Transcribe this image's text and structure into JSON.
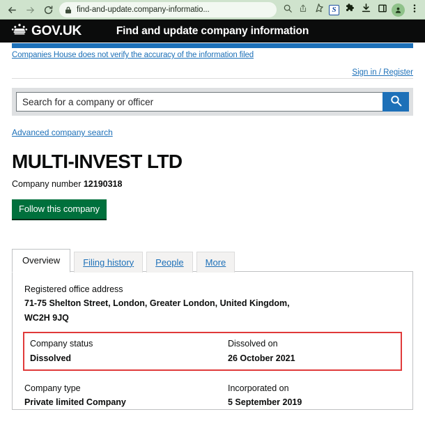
{
  "browser": {
    "back_icon": "back-arrow-icon",
    "forward_icon": "forward-arrow-icon",
    "reload_icon": "reload-icon",
    "lock_icon": "lock-icon",
    "url": "find-and-update.company-informatio...",
    "zoom_icon": "zoom-out-icon",
    "share_icon": "share-icon",
    "bookmark_icon": "star-icon",
    "extension_s_label": "S",
    "extension_puzzle_icon": "puzzle-piece-icon",
    "downloads_icon": "download-icon",
    "sidepanel_icon": "side-panel-icon",
    "profile_icon": "profile-avatar-icon",
    "menu_icon": "three-dot-menu-icon"
  },
  "govuk_header": {
    "crown_icon": "crown-icon",
    "wordmark": "GOV.UK",
    "service_name": "Find and update company information"
  },
  "notice": {
    "text": "Companies House does not verify the accuracy of the information filed"
  },
  "account": {
    "signin_label": "Sign in / Register"
  },
  "search": {
    "placeholder": "Search for a company or officer",
    "value": "",
    "button_icon": "search-icon",
    "advanced_link": "Advanced company search"
  },
  "company": {
    "name": "MULTI-INVEST LTD",
    "number_label": "Company number",
    "number": "12190318",
    "follow_button": "Follow this company"
  },
  "tabs": [
    {
      "label": "Overview",
      "active": true
    },
    {
      "label": "Filing history",
      "active": false
    },
    {
      "label": "People",
      "active": false
    },
    {
      "label": "More",
      "active": false
    }
  ],
  "overview": {
    "address": {
      "label": "Registered office address",
      "line1": "71-75 Shelton Street, London, Greater London, United Kingdom,",
      "line2": "WC2H 9JQ"
    },
    "status": {
      "label": "Company status",
      "value": "Dissolved",
      "date_label": "Dissolved on",
      "date_value": "26 October 2021",
      "highlight_color": "#e03a3a"
    },
    "type": {
      "label": "Company type",
      "value": "Private limited Company",
      "incorporated_label": "Incorporated on",
      "incorporated_value": "5 September 2019"
    }
  },
  "colors": {
    "govuk_black": "#0b0c0c",
    "govuk_blue": "#1d70b8",
    "govuk_green": "#00703c",
    "alert_red": "#e03a3a",
    "chrome_green": "#cfe3cd"
  }
}
